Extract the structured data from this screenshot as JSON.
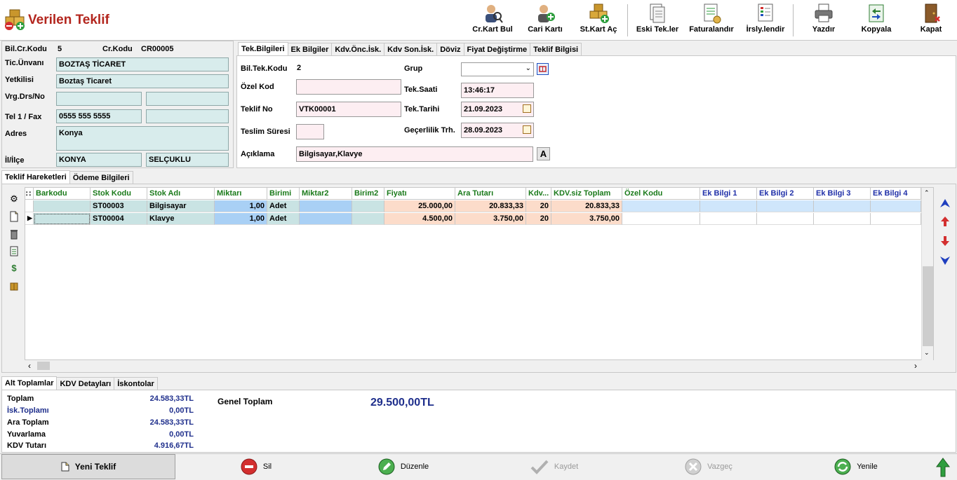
{
  "window": {
    "title": "Verilen Teklif"
  },
  "toolbar": [
    {
      "label": "Cr.Kart Bul",
      "icon": "person-search-icon"
    },
    {
      "label": "Cari Kartı",
      "icon": "person-add-icon"
    },
    {
      "label": "St.Kart Aç",
      "icon": "boxes-add-icon"
    },
    {
      "label": "Eski Tek.ler",
      "icon": "old-documents-icon"
    },
    {
      "label": "Faturalandır",
      "icon": "invoice-icon"
    },
    {
      "label": "İrsly.lendir",
      "icon": "dispatch-note-icon"
    },
    {
      "label": "Yazdır",
      "icon": "printer-icon"
    },
    {
      "label": "Kopyala",
      "icon": "copy-icon"
    },
    {
      "label": "Kapat",
      "icon": "door-exit-icon"
    }
  ],
  "customer": {
    "bil_cr_kodu_label": "Bil.Cr.Kodu",
    "bil_cr_kodu": "5",
    "cr_kodu_label": "Cr.Kodu",
    "cr_kodu": "CR00005",
    "tic_unvani_label": "Tic.Ünvanı",
    "tic_unvani": "BOZTAŞ TİCARET",
    "yetkilisi_label": "Yetkilisi",
    "yetkilisi": "Boztaş Ticaret",
    "vrg_label": "Vrg.Drs/No",
    "vrg_daire": "",
    "vrg_no": "",
    "tel_label": "Tel 1 / Fax",
    "tel": "0555 555 5555",
    "fax": "",
    "adres_label": "Adres",
    "adres": "Konya",
    "il_label": "İl/İlçe",
    "il": "KONYA",
    "ilce": "SELÇUKLU"
  },
  "offer_tabs": [
    "Tek.Bilgileri",
    "Ek Bilgiler",
    "Kdv.Önc.İsk.",
    "Kdv Son.İsk.",
    "Döviz",
    "Fiyat Değiştirme",
    "Teklif Bilgisi"
  ],
  "offer": {
    "bil_tek_kodu_label": "Bil.Tek.Kodu",
    "bil_tek_kodu": "2",
    "grup_label": "Grup",
    "grup": "",
    "ozel_kod_label": "Özel Kod",
    "ozel_kod": "",
    "tek_saati_label": "Tek.Saati",
    "tek_saati": "13:46:17",
    "teklif_no_label": "Teklif No",
    "teklif_no": "VTK00001",
    "tek_tarihi_label": "Tek.Tarihi",
    "tek_tarihi": "21.09.2023",
    "teslim_label": "Teslim Süresi",
    "teslim": "",
    "gecerlilik_label": "Geçerlilik Trh.",
    "gecerlilik": "28.09.2023",
    "aciklama_label": "Açıklama",
    "aciklama": "Bilgisayar,Klavye",
    "a_button": "A"
  },
  "detail_tabs": [
    "Teklif Hareketleri",
    "Ödeme Bilgileri"
  ],
  "grid": {
    "columns": [
      "Barkodu",
      "Stok Kodu",
      "Stok Adı",
      "Miktarı",
      "Birimi",
      "Miktar2",
      "Birim2",
      "Fiyatı",
      "Ara Tutarı",
      "Kdv...",
      "KDV.siz Toplam",
      "Özel Kodu",
      "Ek Bilgi 1",
      "Ek Bilgi 2",
      "Ek Bilgi 3",
      "Ek Bilgi 4"
    ],
    "rows": [
      [
        "",
        "ST00003",
        "Bilgisayar",
        "1,00",
        "Adet",
        "",
        "",
        "25.000,00",
        "20.833,33",
        "20",
        "20.833,33",
        "",
        "",
        "",
        "",
        ""
      ],
      [
        "",
        "ST00004",
        "Klavye",
        "1,00",
        "Adet",
        "",
        "",
        "4.500,00",
        "3.750,00",
        "20",
        "3.750,00",
        "",
        "",
        "",
        "",
        ""
      ]
    ]
  },
  "totals_tabs": [
    "Alt Toplamlar",
    "KDV Detayları",
    "İskontolar"
  ],
  "totals": [
    {
      "label": "Toplam",
      "value": "24.583,33",
      "unit": "TL"
    },
    {
      "label": "İsk.Toplamı",
      "value": "0,00",
      "unit": "TL"
    },
    {
      "label": "Ara Toplam",
      "value": "24.583,33",
      "unit": "TL"
    },
    {
      "label": "Yuvarlama",
      "value": "0,00",
      "unit": "TL"
    },
    {
      "label": "KDV Tutarı",
      "value": "4.916,67",
      "unit": "TL"
    }
  ],
  "genel_toplam": {
    "label": "Genel Toplam",
    "value": "29.500,00",
    "unit": "TL"
  },
  "bottom_buttons": [
    "Yeni Teklif",
    "Sil",
    "Düzenle",
    "Kaydet",
    "Vazgeç",
    "Yenile"
  ]
}
